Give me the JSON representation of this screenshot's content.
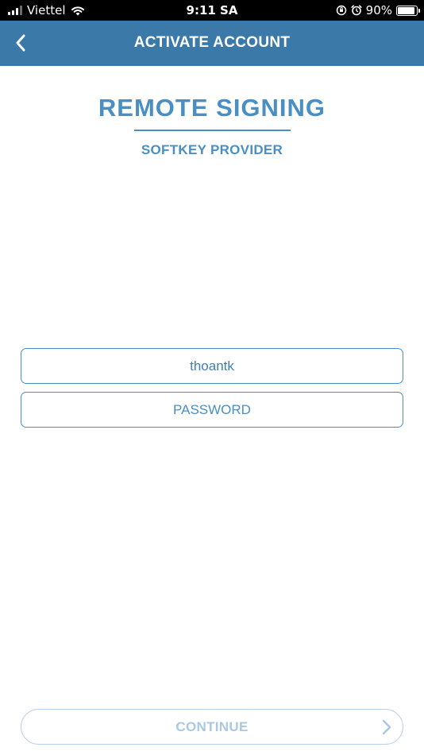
{
  "status_bar": {
    "carrier": "Viettel",
    "time": "9:11 SA",
    "battery_percent": "90%",
    "battery_level": 0.9,
    "icons": [
      "signal-icon",
      "wifi-icon",
      "orientation-lock-icon",
      "alarm-icon",
      "battery-icon"
    ]
  },
  "header": {
    "title": "ACTIVATE ACCOUNT",
    "back_icon": "chevron-left-icon",
    "background": "#3a79a8"
  },
  "brand": {
    "title": "REMOTE SIGNING",
    "subtitle": "SOFTKEY PROVIDER",
    "color": "#4a8fc4"
  },
  "form": {
    "username_value": "thoantk",
    "password_placeholder": "PASSWORD"
  },
  "actions": {
    "continue_label": "CONTINUE",
    "continue_icon": "chevron-right-icon",
    "disabled_color": "#a9c8e1"
  }
}
